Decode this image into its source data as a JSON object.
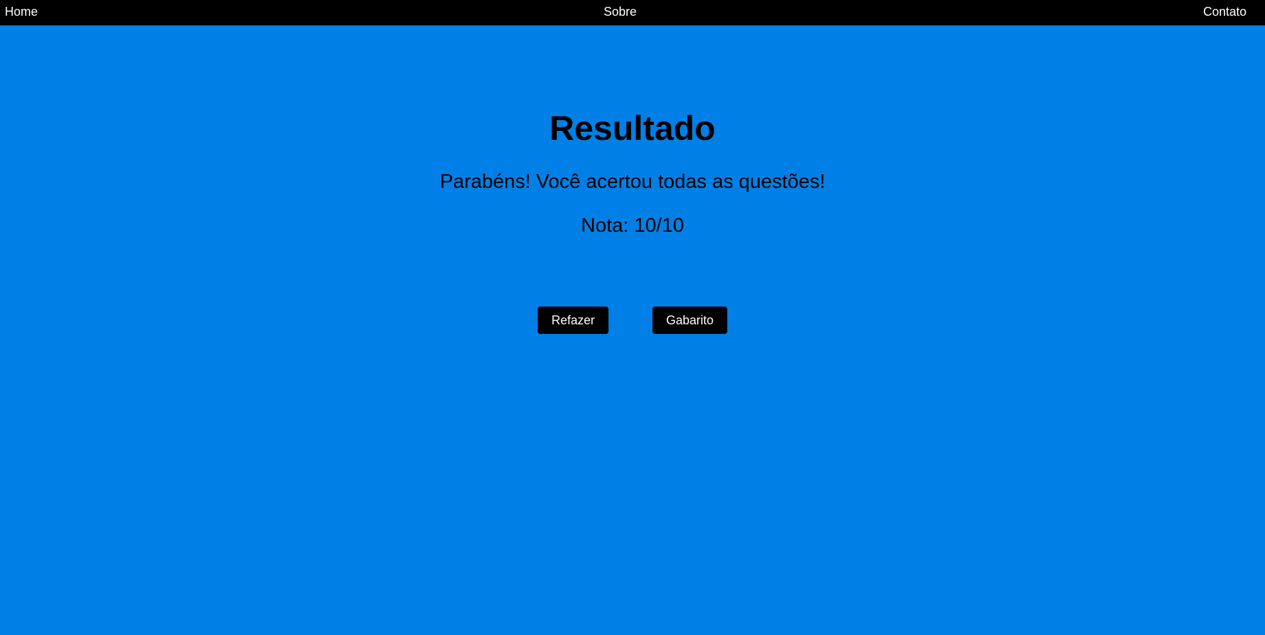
{
  "nav": {
    "home": "Home",
    "sobre": "Sobre",
    "contato": "Contato"
  },
  "result": {
    "title": "Resultado",
    "message": "Parabéns! Você acertou todas as questões!",
    "score": "Nota: 10/10"
  },
  "actions": {
    "redo_label": "Refazer",
    "answers_label": "Gabarito"
  },
  "colors": {
    "background": "#0080e6",
    "navbar": "#000000",
    "button": "#000000",
    "button_text": "#ffffff"
  }
}
